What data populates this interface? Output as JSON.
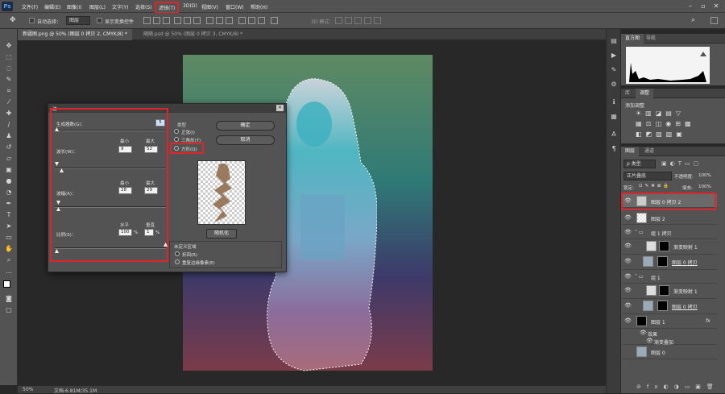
{
  "menubar": {
    "logo": "Ps",
    "items": [
      "文件(F)",
      "编辑(E)",
      "图像(I)",
      "图层(L)",
      "文字(Y)",
      "选择(S)",
      "滤镜(T)",
      "3D(D)",
      "视图(V)",
      "窗口(W)",
      "帮助(H)"
    ]
  },
  "options": {
    "auto_select_label": "自动选择：",
    "auto_select_value": "图层",
    "transform_label": "显示变换控件",
    "mode_3d_label": "3D 模式："
  },
  "tabs": [
    {
      "label": "新疆图.png @ 50% (图层 0 拷贝 2, CMYK/8) *"
    },
    {
      "label": "随随.psd @ 50% (图层 0 拷贝 3, CMYK/8) *"
    }
  ],
  "status": {
    "zoom": "50%",
    "doc": "文档:6.81M/35.1M"
  },
  "histogram_panel": {
    "tabs": [
      "直方图",
      "导航"
    ]
  },
  "adjust_panel": {
    "tabs": [
      "库",
      "调整"
    ],
    "add_label": "添加调整"
  },
  "layers_panel": {
    "tabs": [
      "图层",
      "通道"
    ],
    "filter_label": "ρ 类型",
    "blend_mode": "正片叠底",
    "opacity_label": "不透明度:",
    "opacity_value": "100%",
    "lock_label": "锁定:",
    "fill_label": "填充:",
    "fill_value": "100%",
    "layers": [
      {
        "name": "图层 0 拷贝 2"
      },
      {
        "name": "图层 2"
      },
      {
        "name": "组 1 拷贝"
      },
      {
        "name": "渐变映射 1"
      },
      {
        "name": "图层 0 拷贝"
      },
      {
        "name": "组 1"
      },
      {
        "name": "渐变映射 1"
      },
      {
        "name": "图层 0 拷贝"
      },
      {
        "name": "图层 1"
      },
      {
        "name": "效果"
      },
      {
        "name": "渐变叠加"
      },
      {
        "name": "图层 0"
      }
    ],
    "fx": "fx"
  },
  "dialog": {
    "title": "波",
    "generators_label": "生成器数(G)：",
    "generators_value": "5",
    "min_label": "最小",
    "max_label": "最大",
    "wavelength_label": "波长(W)：",
    "wavelength_min": "9",
    "wavelength_max": "52",
    "amplitude_label": "波幅(A)：",
    "amplitude_min": "28",
    "amplitude_max": "29",
    "h_label": "水平",
    "v_label": "垂直",
    "scale_label": "比例(S)：",
    "scale_h": "100",
    "scale_v": "1",
    "pct": "%",
    "type_label": "类型",
    "type_sine": "正弦(I)",
    "type_triangle": "三角形(T)",
    "type_square": "方形(Q)",
    "ok": "确定",
    "cancel": "取消",
    "randomize": "随机化",
    "undefined_label": "未定义区域",
    "wrap_label": "折回(R)",
    "repeat_label": "重复边缘像素(E)"
  }
}
